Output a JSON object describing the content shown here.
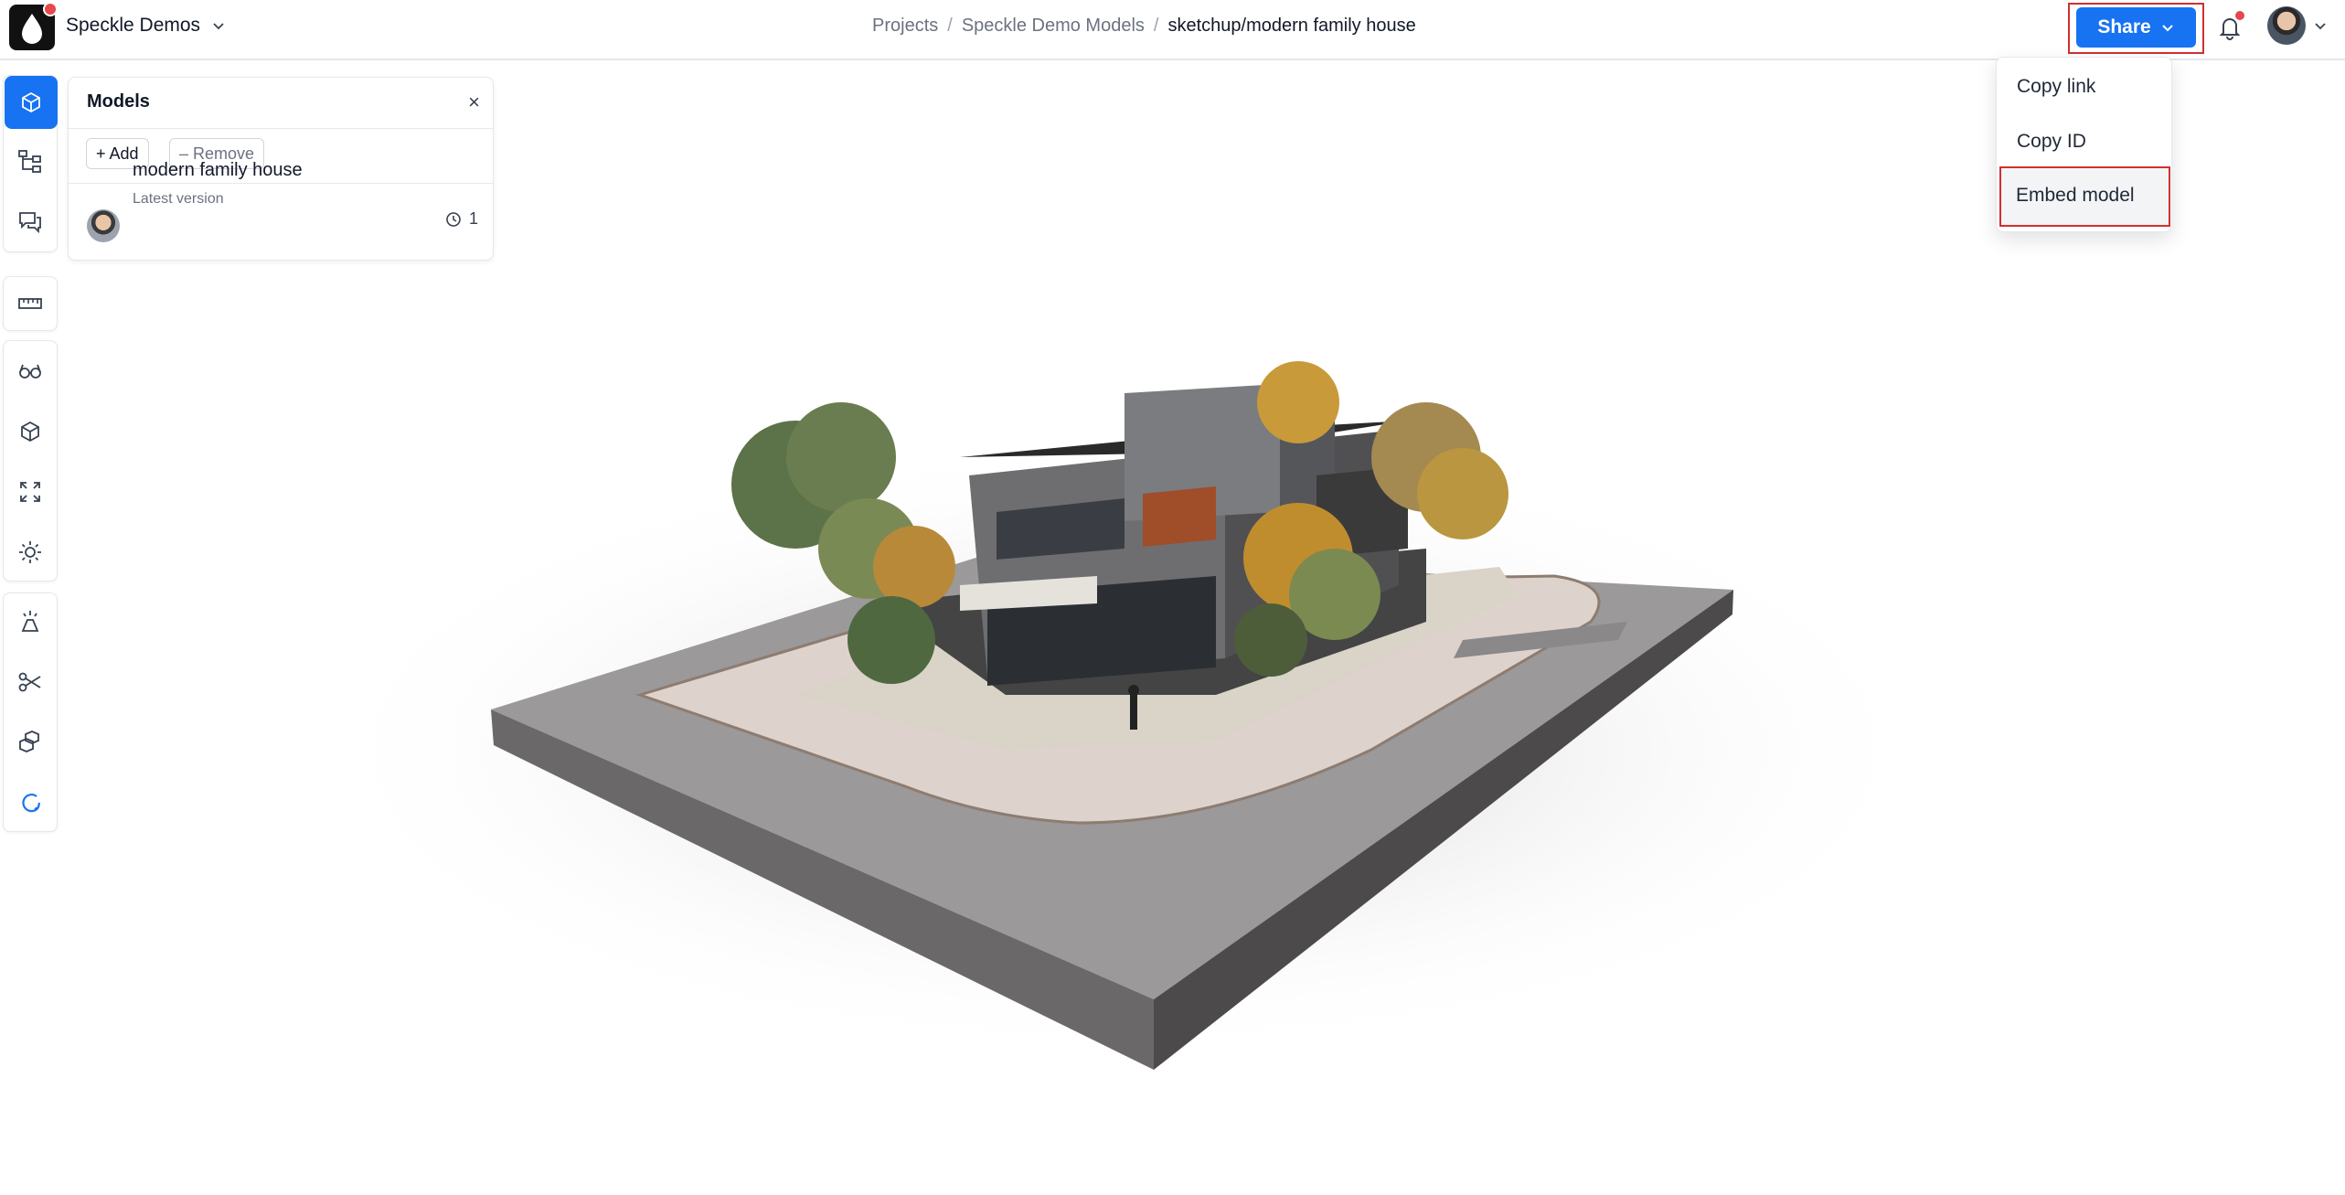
{
  "topbar": {
    "workspace_name": "Speckle Demos",
    "breadcrumb": {
      "projects": "Projects",
      "project": "Speckle Demo Models",
      "model": "sketchup/modern family house",
      "separator": "/"
    },
    "share_label": "Share"
  },
  "share_menu": {
    "items": [
      {
        "label": "Copy link"
      },
      {
        "label": "Copy ID"
      },
      {
        "label": "Embed model"
      }
    ]
  },
  "models_panel": {
    "title": "Models",
    "close_glyph": "×",
    "add_label": "+ Add",
    "remove_label": "– Remove",
    "models": [
      {
        "name": "modern family house",
        "version_label": "Latest version",
        "version_count": "1"
      }
    ]
  },
  "toolbar": {
    "groups": [
      [
        "models-icon",
        "scene-explorer-icon",
        "discussions-icon"
      ],
      [
        "measure-icon"
      ],
      [
        "views-icon",
        "projection-icon",
        "zoom-extents-icon",
        "light-icon"
      ],
      [
        "explode-icon",
        "section-icon",
        "filter-icon",
        "speckle-logo-icon"
      ]
    ]
  },
  "colors": {
    "accent": "#1773f2",
    "highlight_outline": "#d0302f",
    "notification_dot": "#e5484d"
  }
}
